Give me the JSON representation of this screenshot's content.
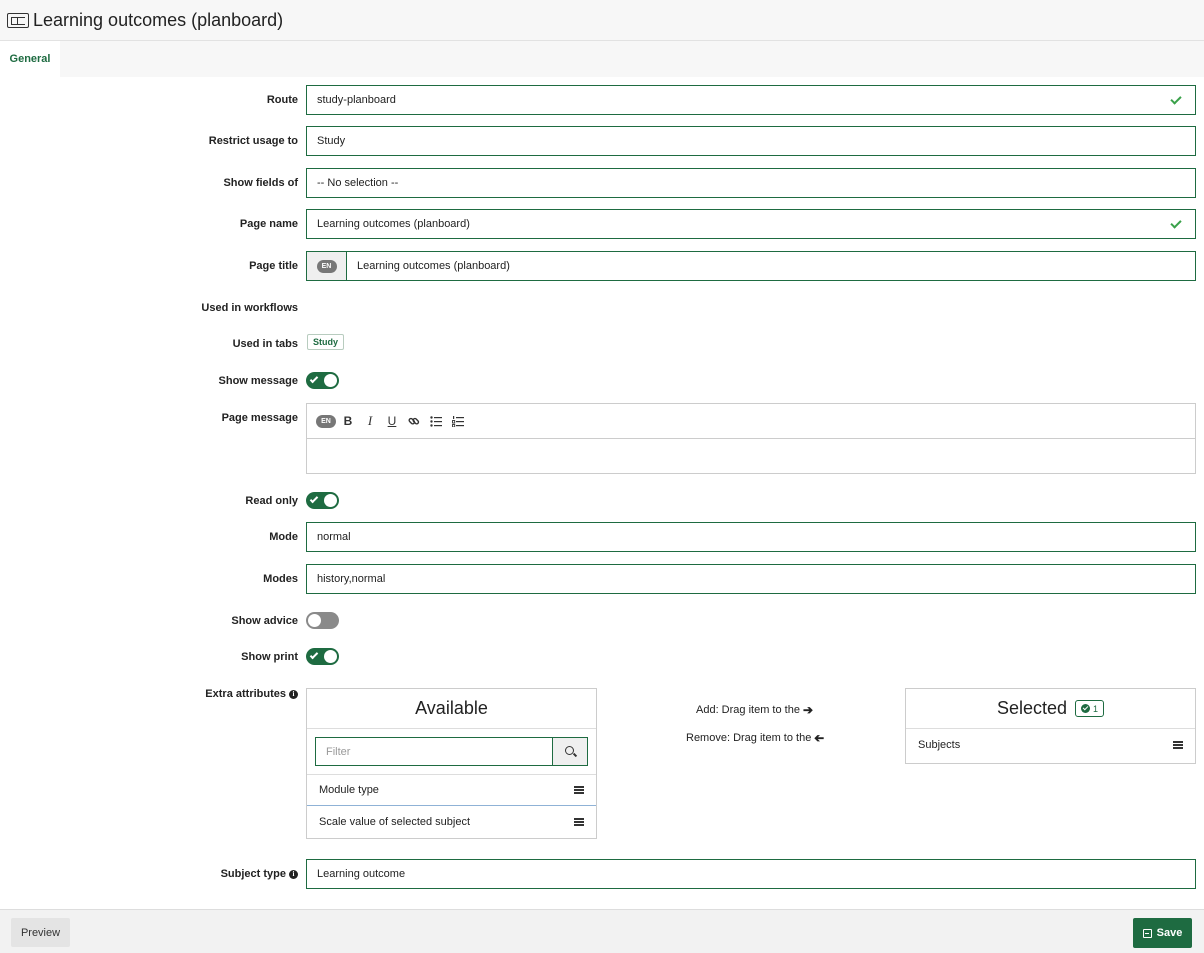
{
  "header": {
    "title": "Learning outcomes (planboard)"
  },
  "tabs": [
    {
      "label": "General"
    }
  ],
  "form": {
    "route": {
      "label": "Route",
      "value": "study-planboard"
    },
    "restrict": {
      "label": "Restrict usage to",
      "value": "Study"
    },
    "show_fields": {
      "label": "Show fields of",
      "value": "-- No selection --"
    },
    "page_name": {
      "label": "Page name",
      "value": "Learning outcomes (planboard)"
    },
    "page_title": {
      "label": "Page title",
      "lang": "EN",
      "value": "Learning outcomes (planboard)"
    },
    "workflows": {
      "label": "Used in workflows"
    },
    "tabs_used": {
      "label": "Used in tabs",
      "tag": "Study"
    },
    "show_message": {
      "label": "Show message",
      "on": true
    },
    "page_message": {
      "label": "Page message",
      "lang": "EN",
      "toolbar": [
        "B",
        "I",
        "U",
        "link",
        "bullet-list",
        "numbered-list"
      ]
    },
    "read_only": {
      "label": "Read only",
      "on": true
    },
    "mode": {
      "label": "Mode",
      "value": "normal"
    },
    "modes": {
      "label": "Modes",
      "value": "history,normal"
    },
    "show_advice": {
      "label": "Show advice",
      "on": false
    },
    "show_print": {
      "label": "Show print",
      "on": true
    },
    "extra_attributes": {
      "label": "Extra attributes",
      "available_title": "Available",
      "filter_placeholder": "Filter",
      "available_items": [
        "Module type",
        "Scale value of selected subject"
      ],
      "add_hint": "Add: Drag item to the",
      "remove_hint": "Remove: Drag item to the",
      "selected_title": "Selected",
      "selected_count": "1",
      "selected_items": [
        "Subjects"
      ]
    },
    "subject_type": {
      "label": "Subject type",
      "value": "Learning outcome"
    }
  },
  "footer": {
    "preview": "Preview",
    "save": "Save"
  },
  "colors": {
    "accent": "#1e6b41",
    "check": "#3aa14a"
  }
}
